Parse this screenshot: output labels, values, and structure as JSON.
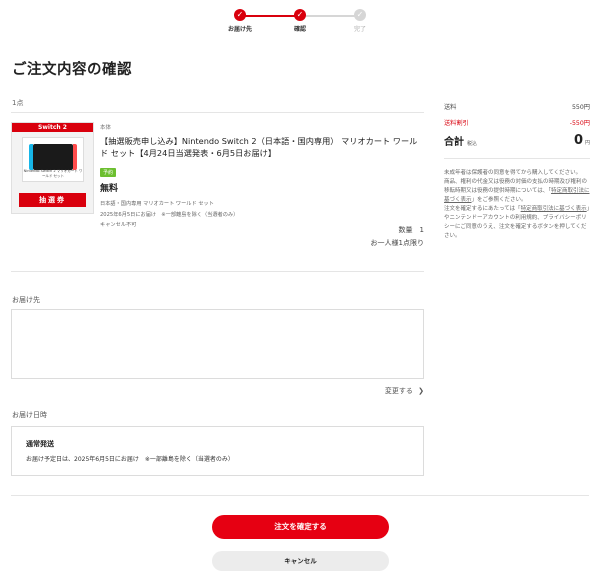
{
  "stepper": {
    "steps": [
      {
        "label": "お届け先"
      },
      {
        "label": "確認"
      },
      {
        "label": "完了"
      }
    ],
    "check": "✓"
  },
  "page_title": "ご注文内容の確認",
  "item_count": "1点",
  "product": {
    "ribbon": "Switch 2",
    "box_caption": "Nintendo Switch 2 マリオカート ワールド セット",
    "lottery_label": "抽選券",
    "store": "本体",
    "name": "【抽選販売申し込み】Nintendo Switch 2（日本語・国内専用） マリオカート ワールド セット【4月24日当選発表・6月5日お届け】",
    "badge": "予約",
    "price": "無料",
    "variant": "日本語・国内専用 マリオカート ワールド セット",
    "delivery_note": "2025年6月5日にお届け　※一部離島を除く（当選者のみ）",
    "cancel_note": "キャンセル不可",
    "quantity": "数量　1",
    "limit": "お一人様1点限り"
  },
  "shipping": {
    "label": "お届け先",
    "change_link": "変更する"
  },
  "delivery_date": {
    "label": "お届け日時",
    "method": "通常発送",
    "detail": "お届け予定日は、2025年6月5日にお届け　※一部離島を除く（当選者のみ）"
  },
  "summary": {
    "shipping_label": "送料",
    "shipping_value": "550円",
    "discount_label": "送料割引",
    "discount_value": "-550円",
    "total_label": "合計",
    "tax_note": "税込",
    "total_value": "0",
    "total_unit": "円",
    "note1": "未成年者は保護者の同意を得てから購入してください。",
    "note2a": "商品、権利の代金又は役務の対価の支払の時期及び権利の移転時期又は役務の提供時期については、「",
    "note2_link": "特定商取引法に基づく表示",
    "note2b": "」をご参照ください。",
    "note3a": "注文を確定するにあたっては「",
    "note3_link": "特定商取引法に基づく表示",
    "note3b": "」やニンテンドーアカウントの利用規約、プライバシーポリシーにご同意のうえ、注文を確定するボタンを押してください。"
  },
  "buttons": {
    "confirm": "注文を確定する",
    "cancel": "キャンセル",
    "chevron": "❯"
  },
  "colors": {
    "accent": "#e60012",
    "step_active": "#d9000d",
    "step_inactive": "#d6d6d6",
    "badge_green": "#6cbf2f"
  }
}
